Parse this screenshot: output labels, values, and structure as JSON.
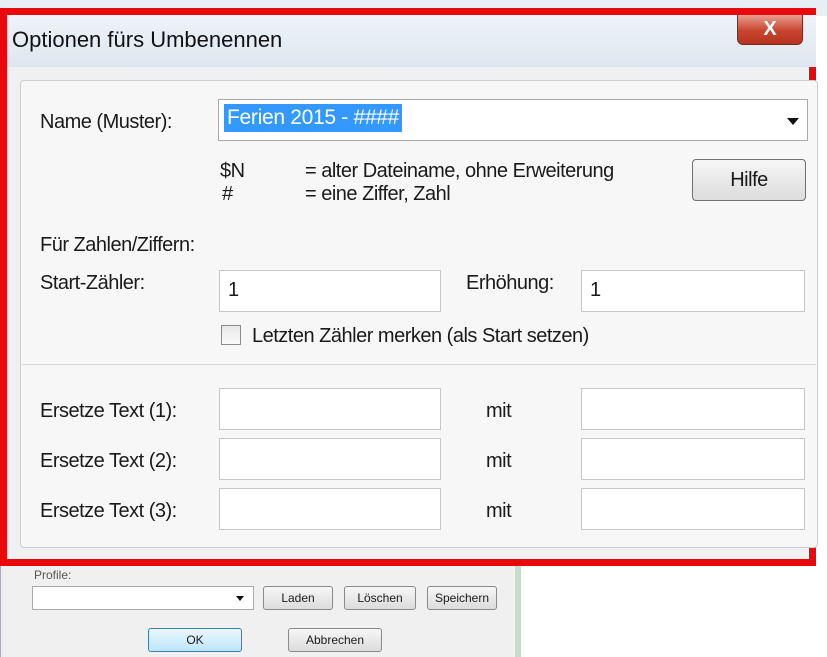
{
  "dialog": {
    "title": "Optionen fürs Umbenennen",
    "close_label": "X"
  },
  "name_pattern": {
    "label": "Name (Muster):",
    "value": "Ferien 2015 - ####"
  },
  "legend": {
    "n_key": "$N",
    "n_desc": "= alter Dateiname, ohne Erweiterung",
    "hash_key": "#",
    "hash_desc": "= eine Ziffer, Zahl"
  },
  "help_button": "Hilfe",
  "numbers": {
    "section_label": "Für Zahlen/Ziffern:",
    "start_label": "Start-Zähler:",
    "start_value": "1",
    "increment_label": "Erhöhung:",
    "increment_value": "1",
    "remember_label": "Letzten Zähler merken (als Start setzen)",
    "remember_checked": false
  },
  "replace": {
    "with_label": "mit",
    "rows": [
      {
        "label": "Ersetze Text (1):",
        "find": "",
        "replace": ""
      },
      {
        "label": "Ersetze Text (2):",
        "find": "",
        "replace": ""
      },
      {
        "label": "Ersetze Text (3):",
        "find": "",
        "replace": ""
      }
    ]
  },
  "background_window": {
    "profile_label": "Profile:",
    "load_button": "Laden",
    "delete_button": "Löschen",
    "save_button": "Speichern",
    "ok_button": "OK",
    "cancel_button": "Abbrechen"
  },
  "colors": {
    "highlight_frame": "#e8090d",
    "selection": "#3399ff",
    "close_button": "#c9442f"
  }
}
